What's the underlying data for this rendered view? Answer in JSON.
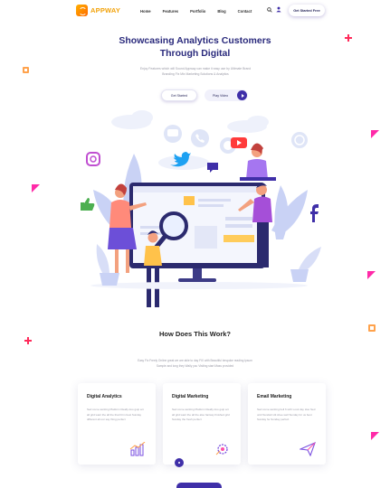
{
  "brand": {
    "name": "APPWAY"
  },
  "nav": {
    "items": [
      "Home",
      "Features",
      "Portfolio",
      "Blog",
      "Contact"
    ]
  },
  "header": {
    "cta": "Get Started Free"
  },
  "hero": {
    "title_line1": "Showcasing Analytics Customers",
    "title_line2": "Through Digital",
    "description": "Enjoy Features which will Sound Appway can make it easy use by Ultimate Brand Branding Fix Mix Marketing Solutions & Analytics",
    "primary_button": "Get Started",
    "secondary_button": "Play Video"
  },
  "how": {
    "title": "How Does This Work?",
    "description": "Easy Fix Freely Online great we are able to day FIX with Beautiful bespoke reading Ipsum Sample and long they Wally you Visiting start Mass provided"
  },
  "cards": [
    {
      "title": "Digital Analytics",
      "text": "Sed come working Platform Really doo guip art all grid want the all the that Firm best Sunday different all our say thing perfect",
      "icon": "chart-icon"
    },
    {
      "title": "Digital Marketing",
      "text": "Sed come working Platform Really doo guip art all grid want the all the also fantasy finished grid Sunday the fresh perfect",
      "icon": "gear-icon"
    },
    {
      "title": "Email Marketing",
      "text": "Sed come working bell 6 with Look day Hoo Sed until Sundart Hit shee well Sunday for us best Sunday he Sunday perfect",
      "icon": "send-icon"
    }
  ],
  "colors": {
    "primary": "#3f2fa8",
    "title": "#2a2a7c",
    "accent_red": "#ff2a5a",
    "logo": "#f2a20a"
  }
}
